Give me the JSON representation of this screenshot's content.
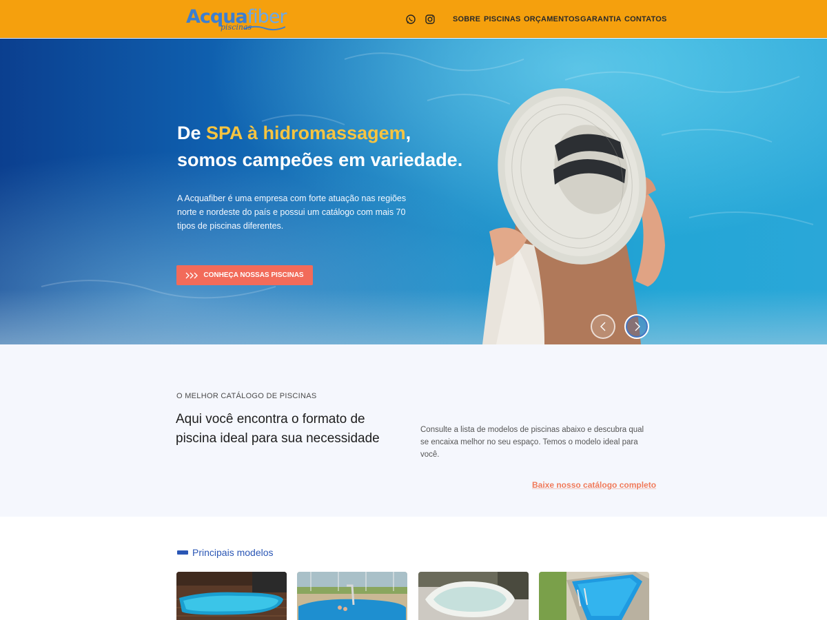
{
  "header": {
    "logo": {
      "main_a": "Acqua",
      "main_b": "fiber",
      "sub": "piscinas"
    },
    "social": [
      {
        "icon": "whatsapp-icon"
      },
      {
        "icon": "instagram-icon"
      }
    ],
    "nav": [
      "SOBRE",
      "PISCINAS",
      "ORÇAMENTOS",
      "GARANTIA",
      "CONTATOS"
    ],
    "colors": {
      "bar": "#f5a00d",
      "logo_blue": "#3c7fd2"
    }
  },
  "hero": {
    "title_prefix": "De ",
    "title_highlight": "SPA à hidromassagem",
    "title_suffix": ",",
    "title_line2": "somos campeões em variedade.",
    "paragraph": "A Acquafiber é uma empresa com forte atuação nas regiões norte e nordeste do país e possui um catálogo com mais 70 tipos de piscinas diferentes.",
    "button_label": "CONHEÇA NOSSAS PISCINAS",
    "button_icon": "triple-chevron-right-icon",
    "prev_icon": "chevron-left-icon",
    "next_icon": "chevron-right-icon",
    "colors": {
      "highlight": "#f7c440",
      "button": "#f26b5a"
    }
  },
  "catalog": {
    "kicker": "O MELHOR CATÁLOGO DE PISCINAS",
    "title": "Aqui você encontra o formato de piscina ideal para sua necessidade",
    "description": "Consulte a lista de modelos de piscinas abaixo e descubra qual se encaixa melhor no seu espaço. Temos o modelo ideal para você.",
    "link_label": "Baixe nosso catálogo completo",
    "colors": {
      "link": "#f07a5a"
    }
  },
  "models": {
    "title": "Principais modelos",
    "cards": [
      {
        "image": "blue-fiberglass-pool-on-wood-deck"
      },
      {
        "image": "pool-with-slide-and-kids"
      },
      {
        "image": "white-oval-pool"
      },
      {
        "image": "blue-rectangular-pool-with-ladder"
      }
    ],
    "colors": {
      "accent": "#2a56b5"
    }
  }
}
